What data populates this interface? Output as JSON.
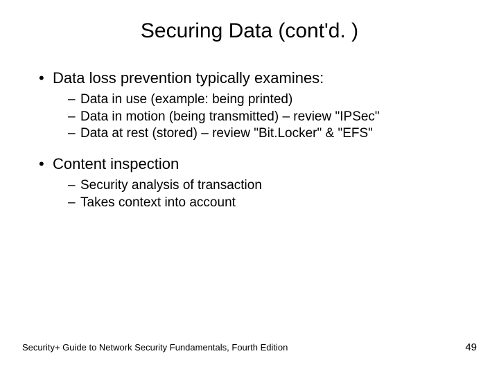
{
  "title": "Securing Data (cont'd. )",
  "bullets": [
    {
      "text": "Data loss prevention typically examines:",
      "children": [
        "Data in use (example: being printed)",
        "Data in motion (being transmitted) – review \"IPSec\"",
        "Data at rest (stored) – review \"Bit.Locker\" & \"EFS\""
      ]
    },
    {
      "text": "Content inspection",
      "children": [
        "Security analysis of transaction",
        "Takes context into account"
      ]
    }
  ],
  "footer": {
    "source": "Security+ Guide to Network Security Fundamentals, Fourth Edition",
    "page": "49"
  }
}
